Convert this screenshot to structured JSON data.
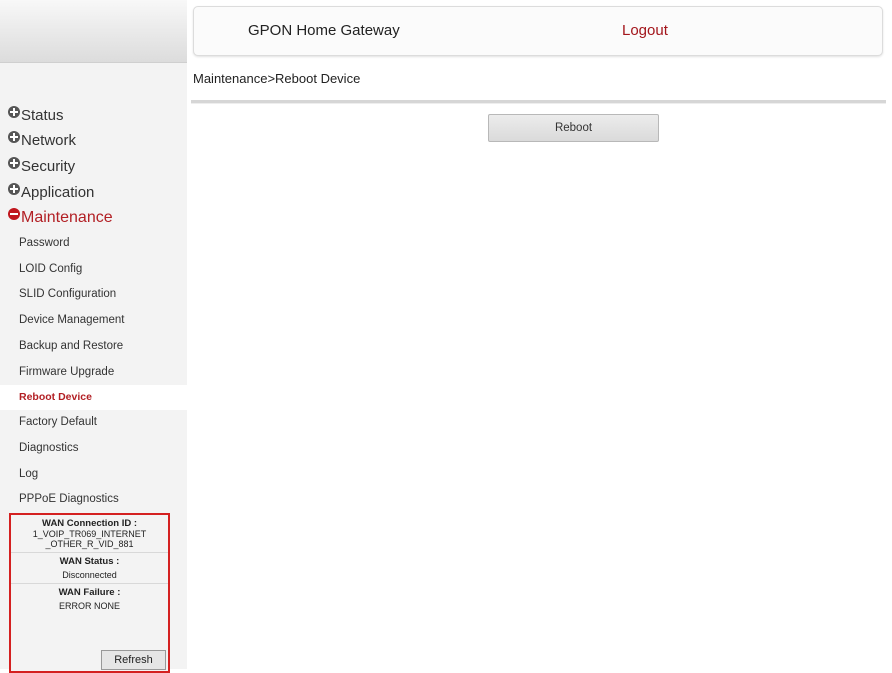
{
  "header": {
    "title": "GPON Home Gateway",
    "logout_label": "Logout"
  },
  "breadcrumb": "Maintenance>Reboot Device",
  "main": {
    "reboot_button_label": "Reboot"
  },
  "sidebar": {
    "categories": [
      {
        "label": "Status",
        "icon": "plus-circle-icon",
        "expanded": false
      },
      {
        "label": "Network",
        "icon": "plus-circle-icon",
        "expanded": false
      },
      {
        "label": "Security",
        "icon": "plus-circle-icon",
        "expanded": false
      },
      {
        "label": "Application",
        "icon": "plus-circle-icon",
        "expanded": false
      },
      {
        "label": "Maintenance",
        "icon": "minus-circle-icon",
        "expanded": true
      }
    ],
    "maintenance_items": [
      {
        "label": "Password"
      },
      {
        "label": "LOID Config"
      },
      {
        "label": "SLID Configuration"
      },
      {
        "label": "Device Management"
      },
      {
        "label": "Backup and Restore"
      },
      {
        "label": "Firmware Upgrade"
      },
      {
        "label": "Reboot Device",
        "selected": true
      },
      {
        "label": "Factory Default"
      },
      {
        "label": "Diagnostics"
      },
      {
        "label": "Log"
      },
      {
        "label": "PPPoE Diagnostics"
      }
    ]
  },
  "wan": {
    "connection_id_label": "WAN Connection ID :",
    "connection_id_line1": "1_VOIP_TR069_INTERNET",
    "connection_id_line2": "_OTHER_R_VID_881",
    "status_label": "WAN Status :",
    "status_value": "Disconnected",
    "failure_label": "WAN Failure :",
    "failure_value": "ERROR NONE",
    "refresh_label": "Refresh"
  },
  "colors": {
    "accent_red": "#b21f24",
    "wan_box_border": "#d42020",
    "sidebar_bg": "#f3f3f3"
  }
}
